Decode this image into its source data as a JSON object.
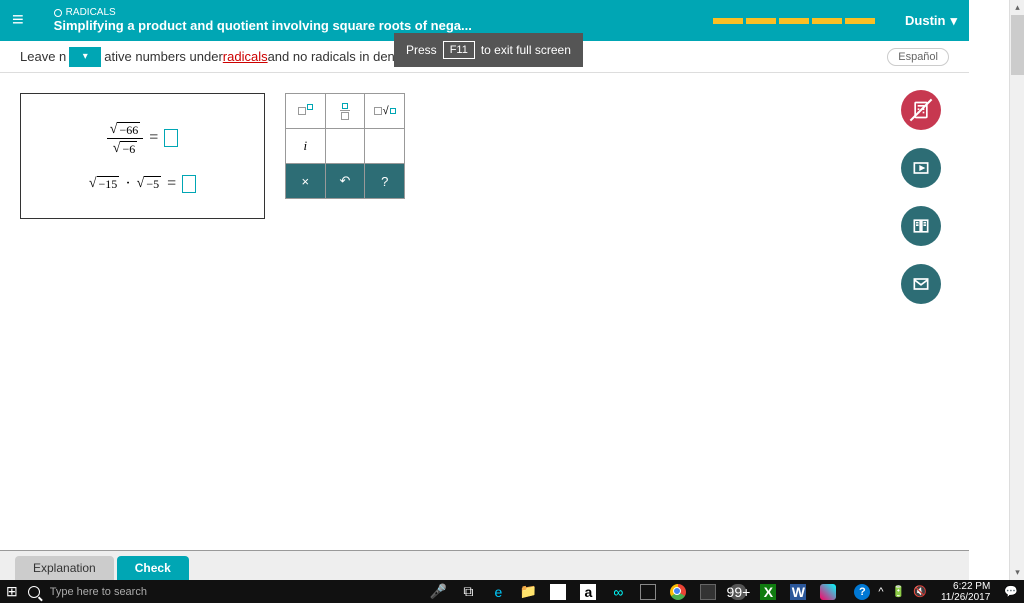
{
  "header": {
    "category": "RADICALS",
    "title": "Simplifying a product and quotient involving square roots of nega...",
    "user": "Dustin"
  },
  "instruction": {
    "pre": "Leave n",
    "mid": "ative numbers under ",
    "link": "radicals",
    "post": " and no radicals in denominators."
  },
  "espanol": "Español",
  "fullscreen_tip": {
    "pre": "Press",
    "key": "F11",
    "post": "to exit full screen"
  },
  "problem": {
    "num": "−66",
    "den": "−6",
    "prod_a": "−15",
    "prod_b": "−5"
  },
  "keypad": {
    "i_label": "i",
    "x_label": "×",
    "undo_label": "↶",
    "help_label": "?"
  },
  "footer": {
    "explanation": "Explanation",
    "check": "Check"
  },
  "taskbar": {
    "search_placeholder": "Type here to search",
    "amazon": "a",
    "badge": "99+",
    "excel": "X",
    "word": "W",
    "help": "?",
    "caret": "^",
    "time": "6:22 PM",
    "date": "11/26/2017"
  }
}
